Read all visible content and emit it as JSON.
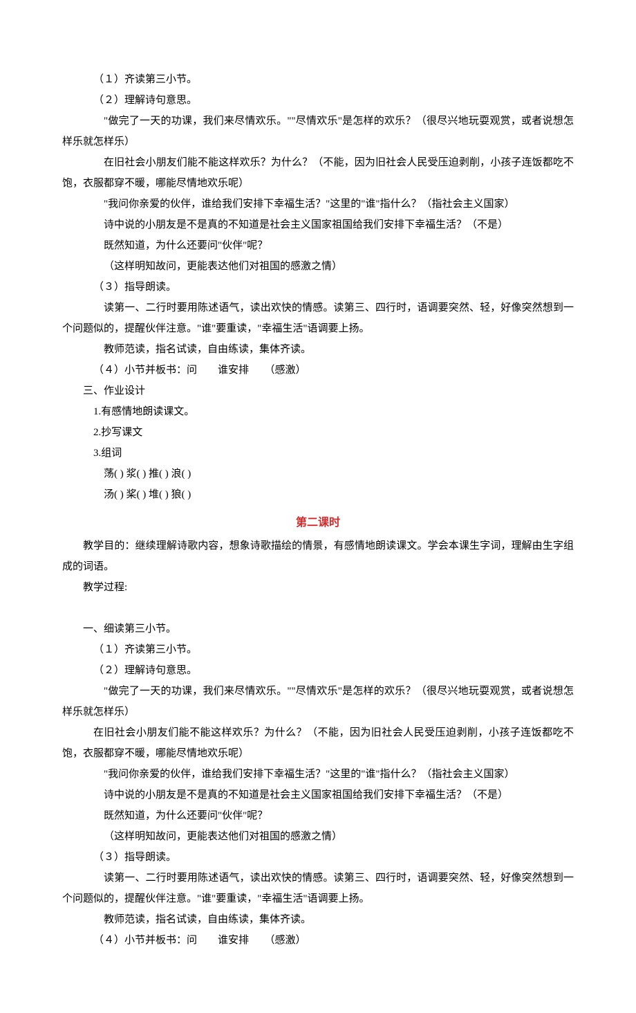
{
  "block1": {
    "l1": "（１）齐读第三小节。",
    "l2": "（２）理解诗句意思。",
    "l3": "\"做完了一天的功课，我们来尽情欢乐。\"\"尽情欢乐\"是怎样的欢乐？（很尽兴地玩耍观赏，或者说想怎样乐就怎样乐）",
    "l4": "在旧社会小朋友们能不能这样欢乐？为什么？（不能，因为旧社会人民受压迫剥削，小孩子连饭都吃不饱，衣服都穿不暖，哪能尽情地欢乐呢）",
    "l5": "\"我问你亲爱的伙伴，谁给我们安排下幸福生活？\"这里的\"谁\"指什么？（指社会主义国家）",
    "l6": "诗中说的小朋友是不是真的不知道是社会主义国家祖国给我们安排下幸福生活？（不是）",
    "l7": "既然知道，为什么还要问\"伙伴\"呢？",
    "l8": "（这样明知故问，更能表达他们对祖国的感激之情）",
    "l9": "（３）指导朗读。",
    "l10": "读第一、二行时要用陈述语气，读出欢快的情感。读第三、四行时，语调要突然、轻，好像突然想到一个问题似的，提醒伙伴注意。\"谁\"要重读，\"幸福生活\"语调要上扬。",
    "l11": "教师范读，指名试读，自由练读，集体齐读。",
    "l12": "（４）小节并板书：问　　谁安排　　（感激）"
  },
  "homework": {
    "heading": "三、作业设计",
    "item1": "1.有感情地朗读课文。",
    "item2": "2.抄写课文",
    "item3": "3.组词",
    "row1": "荡(  )  浆(  )  推(  )  浪(  )",
    "row2": "汤(  )  桨(  )  堆(  )  狼(  )"
  },
  "lesson2": {
    "title": "第二课时",
    "objective": "教学目的：继续理解诗歌内容，想象诗歌描绘的情景，有感情地朗读课文。学会本课生字词，理解由生字组成的词语。",
    "process_label": "教学过程:"
  },
  "block2": {
    "heading": "一、细读第三小节。",
    "l1": "（１）齐读第三小节。",
    "l2": "（２）理解诗句意思。",
    "l3": "\"做完了一天的功课，我们来尽情欢乐。\"\"尽情欢乐\"是怎样的欢乐？（很尽兴地玩耍观赏，或者说想怎样乐就怎样乐）",
    "l4": "在旧社会小朋友们能不能这样欢乐？为什么？（不能，因为旧社会人民受压迫剥削，小孩子连饭都吃不饱，衣服都穿不暖，哪能尽情地欢乐呢）",
    "l5": "\"我问你亲爱的伙伴，谁给我们安排下幸福生活？\"这里的\"谁\"指什么？（指社会主义国家）",
    "l6": "诗中说的小朋友是不是真的不知道是社会主义国家祖国给我们安排下幸福生活？（不是）",
    "l7": "既然知道，为什么还要问\"伙伴\"呢？",
    "l8": "（这样明知故问，更能表达他们对祖国的感激之情）",
    "l9": "（３）指导朗读。",
    "l10": "读第一、二行时要用陈述语气，读出欢快的情感。读第三、四行时，语调要突然、轻，好像突然想到一个问题似的，提醒伙伴注意。\"谁\"要重读，\"幸福生活\"语调要上扬。",
    "l11": "教师范读，指名试读，自由练读，集体齐读。",
    "l12": "（４）小节并板书：问　　谁安排　　（感激）"
  }
}
